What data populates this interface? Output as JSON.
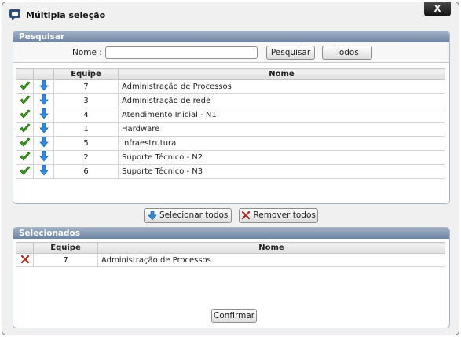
{
  "window": {
    "title": "Múltipla seleção",
    "close_label": "X"
  },
  "search_panel": {
    "header": "Pesquisar",
    "name_label": "Nome :",
    "name_value": "",
    "search_button": "Pesquisar",
    "all_button": "Todos",
    "columns": [
      "Equipe",
      "Nome"
    ],
    "rows": [
      {
        "equipe": "7",
        "nome": "Administração de Processos"
      },
      {
        "equipe": "3",
        "nome": "Administração de rede"
      },
      {
        "equipe": "4",
        "nome": "Atendimento Inicial - N1"
      },
      {
        "equipe": "1",
        "nome": "Hardware"
      },
      {
        "equipe": "5",
        "nome": "Infraestrutura"
      },
      {
        "equipe": "2",
        "nome": "Suporte Técnico - N2"
      },
      {
        "equipe": "6",
        "nome": "Suporte Técnico - N3"
      }
    ]
  },
  "actions": {
    "select_all": "Selecionar todos",
    "remove_all": "Remover todos"
  },
  "selected_panel": {
    "header": "Selecionados",
    "columns": [
      "Equipe",
      "Nome"
    ],
    "rows": [
      {
        "equipe": "7",
        "nome": "Administração de Processos"
      }
    ]
  },
  "footer": {
    "confirm_button": "Confirmar"
  },
  "icons": {
    "app": "chat-window-icon",
    "row_select": "check-icon",
    "row_move": "arrow-down-icon",
    "row_remove": "red-x-icon"
  },
  "colors": {
    "panel_header": "#7d93b0",
    "check": "#3aa21a",
    "arrow": "#2f8be0",
    "remove": "#d42a1e"
  }
}
